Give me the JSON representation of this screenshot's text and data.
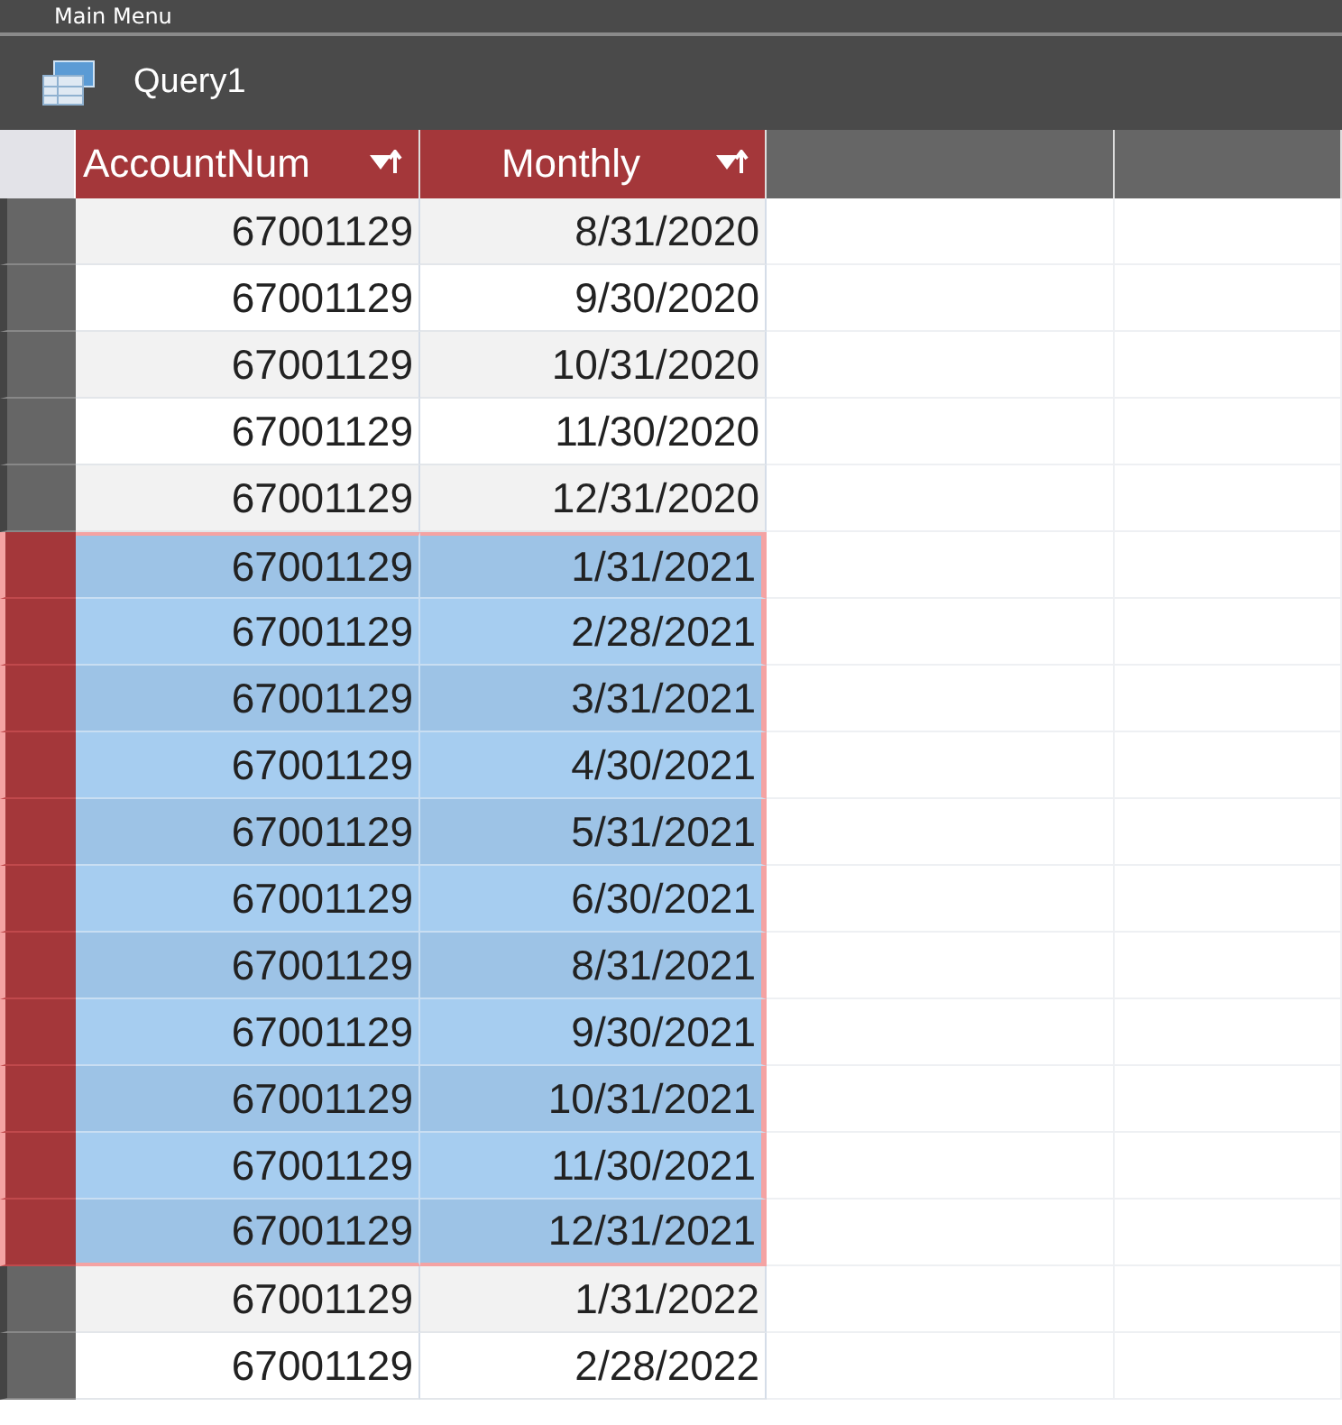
{
  "back_window": {
    "title": "Main Menu"
  },
  "window": {
    "title": "Query1"
  },
  "table": {
    "columns": [
      {
        "label": "AccountNum",
        "filtered": true
      },
      {
        "label": "Monthly",
        "filtered": true
      }
    ],
    "rows": [
      {
        "cells": [
          "67001129",
          "8/31/2020"
        ],
        "selected": false
      },
      {
        "cells": [
          "67001129",
          "9/30/2020"
        ],
        "selected": false
      },
      {
        "cells": [
          "67001129",
          "10/31/2020"
        ],
        "selected": false
      },
      {
        "cells": [
          "67001129",
          "11/30/2020"
        ],
        "selected": false
      },
      {
        "cells": [
          "67001129",
          "12/31/2020"
        ],
        "selected": false
      },
      {
        "cells": [
          "67001129",
          "1/31/2021"
        ],
        "selected": true
      },
      {
        "cells": [
          "67001129",
          "2/28/2021"
        ],
        "selected": true
      },
      {
        "cells": [
          "67001129",
          "3/31/2021"
        ],
        "selected": true
      },
      {
        "cells": [
          "67001129",
          "4/30/2021"
        ],
        "selected": true
      },
      {
        "cells": [
          "67001129",
          "5/31/2021"
        ],
        "selected": true
      },
      {
        "cells": [
          "67001129",
          "6/30/2021"
        ],
        "selected": true
      },
      {
        "cells": [
          "67001129",
          "8/31/2021"
        ],
        "selected": true
      },
      {
        "cells": [
          "67001129",
          "9/30/2021"
        ],
        "selected": true
      },
      {
        "cells": [
          "67001129",
          "10/31/2021"
        ],
        "selected": true
      },
      {
        "cells": [
          "67001129",
          "11/30/2021"
        ],
        "selected": true
      },
      {
        "cells": [
          "67001129",
          "12/31/2021"
        ],
        "selected": true
      },
      {
        "cells": [
          "67001129",
          "1/31/2022"
        ],
        "selected": false
      },
      {
        "cells": [
          "67001129",
          "2/28/2022"
        ],
        "selected": false
      }
    ]
  }
}
